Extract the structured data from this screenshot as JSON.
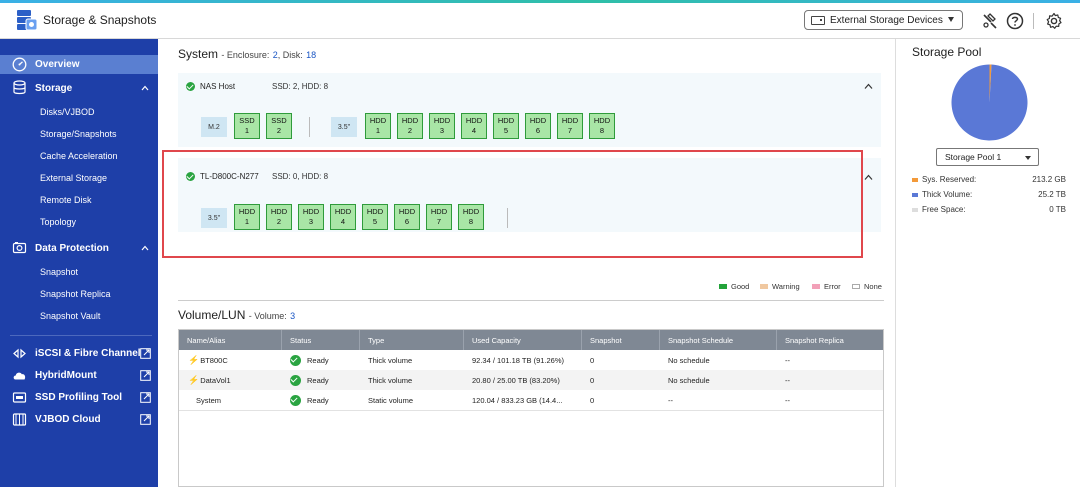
{
  "app": {
    "title": "Storage & Snapshots"
  },
  "header": {
    "external_devices": "External Storage Devices"
  },
  "sidebar": {
    "overview": "Overview",
    "storage": "Storage",
    "storage_items": [
      "Disks/VJBOD",
      "Storage/Snapshots",
      "Cache Acceleration",
      "External Storage",
      "Remote Disk",
      "Topology"
    ],
    "data_protection": "Data Protection",
    "dp_items": [
      "Snapshot",
      "Snapshot Replica",
      "Snapshot Vault"
    ],
    "iscsi": "iSCSI & Fibre Channel",
    "hybridmount": "HybridMount",
    "ssd_tool": "SSD Profiling Tool",
    "vjbod_cloud": "VJBOD Cloud"
  },
  "system": {
    "title": "System",
    "enclosure_label": "- Enclosure:",
    "enclosure_count": "2",
    "disk_label": ", Disk:",
    "disk_count": "18",
    "nas": {
      "name": "NAS Host",
      "info": "SSD: 2, HDD: 8",
      "m2_label": "M.2",
      "ssd_bays": [
        {
          "type": "SSD",
          "num": "1"
        },
        {
          "type": "SSD",
          "num": "2"
        }
      ],
      "hdd_label": "3.5\"",
      "hdd_bays": [
        {
          "type": "HDD",
          "num": "1"
        },
        {
          "type": "HDD",
          "num": "2"
        },
        {
          "type": "HDD",
          "num": "3"
        },
        {
          "type": "HDD",
          "num": "4"
        },
        {
          "type": "HDD",
          "num": "5"
        },
        {
          "type": "HDD",
          "num": "6"
        },
        {
          "type": "HDD",
          "num": "7"
        },
        {
          "type": "HDD",
          "num": "8"
        }
      ]
    },
    "expansion": {
      "name": "TL-D800C-N277",
      "info": "SSD: 0, HDD: 8",
      "hdd_label": "3.5\"",
      "hdd_bays": [
        {
          "type": "HDD",
          "num": "1"
        },
        {
          "type": "HDD",
          "num": "2"
        },
        {
          "type": "HDD",
          "num": "3"
        },
        {
          "type": "HDD",
          "num": "4"
        },
        {
          "type": "HDD",
          "num": "5"
        },
        {
          "type": "HDD",
          "num": "6"
        },
        {
          "type": "HDD",
          "num": "7"
        },
        {
          "type": "HDD",
          "num": "8"
        }
      ]
    }
  },
  "legend": {
    "good": "Good",
    "warning": "Warning",
    "error": "Error",
    "none": "None",
    "colors": {
      "good": "#23a33a",
      "warning": "#f0c8a0",
      "error": "#f2a0b8",
      "none": "#ffffff"
    }
  },
  "volumes": {
    "title": "Volume/LUN",
    "count_label": "- Volume:",
    "count": "3",
    "columns": [
      "Name/Alias",
      "Status",
      "Type",
      "Used Capacity",
      "Snapshot",
      "Snapshot Schedule",
      "Snapshot Replica"
    ],
    "rows": [
      {
        "name": "BT800C",
        "status": "Ready",
        "type": "Thick volume",
        "used": "92.34 / 101.18 TB (91.26%)",
        "snapshot": "0",
        "schedule": "No schedule",
        "replica": "--"
      },
      {
        "name": "DataVol1",
        "status": "Ready",
        "type": "Thick volume",
        "used": "20.80 / 25.00 TB (83.20%)",
        "snapshot": "0",
        "schedule": "No schedule",
        "replica": "--"
      },
      {
        "name": "System",
        "status": "Ready",
        "type": "Static volume",
        "used": "120.04 / 833.23 GB (14.4...",
        "snapshot": "0",
        "schedule": "--",
        "replica": "--"
      }
    ]
  },
  "storage_pool": {
    "title": "Storage Pool",
    "selected": "Storage Pool 1",
    "legend": [
      {
        "label": "Sys. Reserved:",
        "value": "213.2 GB",
        "color": "#f39a3a"
      },
      {
        "label": "Thick Volume:",
        "value": "25.2 TB",
        "color": "#5a78d6"
      },
      {
        "label": "Free Space:",
        "value": "0 TB",
        "color": "#dddddd"
      }
    ],
    "chart_data": {
      "type": "pie",
      "categories": [
        "Sys. Reserved",
        "Thick Volume",
        "Free Space"
      ],
      "values": [
        0.2132,
        25.2,
        0
      ],
      "units": "TB"
    }
  }
}
